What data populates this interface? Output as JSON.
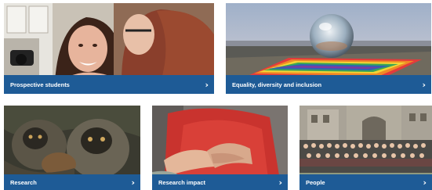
{
  "cards": [
    {
      "label": "Prospective students",
      "chevron": "›",
      "image_alt": "two students smiling with microscope"
    },
    {
      "label": "Equality, diversity and inclusion",
      "chevron": "›",
      "image_alt": "crystal ball on rainbow flag by the sea"
    },
    {
      "label": "Research",
      "chevron": "›",
      "image_alt": "monkeys with infant"
    },
    {
      "label": "Research impact",
      "chevron": "›",
      "image_alt": "clasped hands"
    },
    {
      "label": "People",
      "chevron": "›",
      "image_alt": "group photo in front of building"
    }
  ],
  "colors": {
    "bar": "#1e5b96",
    "text": "#ffffff"
  }
}
